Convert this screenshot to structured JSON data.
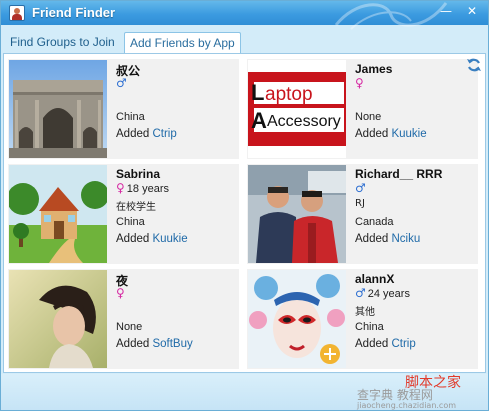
{
  "window": {
    "title": "Friend Finder",
    "minimize_glyph": "—",
    "close_glyph": "✕"
  },
  "tabs": [
    {
      "label": "Find Groups to Join",
      "selected": false
    },
    {
      "label": "Add Friends by App",
      "selected": true
    }
  ],
  "accent_color": "#3c9be0",
  "link_color": "#1f6aa8",
  "added_prefix": "Added",
  "toolbar": {
    "refresh_icon": "refresh-icon"
  },
  "friends": [
    {
      "name": "叔公",
      "gender_symbol": "♂",
      "gender": "male",
      "age": "",
      "note": "",
      "location": "China",
      "app": "Ctrip",
      "photo": "arch-photo"
    },
    {
      "name": "James",
      "gender_symbol": "♀",
      "gender": "female",
      "age": "",
      "note": "",
      "location": "None",
      "app": "Kuukie",
      "photo": "laptop-accessory-logo",
      "photo_text_1": "aptop",
      "photo_text_2": "Accessory"
    },
    {
      "name": "Sabrina",
      "gender_symbol": "♀",
      "gender": "female",
      "age": "18 years",
      "note": "在校学生",
      "location": "China",
      "app": "Kuukie",
      "photo": "cartoon-house-illustration"
    },
    {
      "name": "Richard__ RRR",
      "gender_symbol": "♂",
      "gender": "male",
      "age": "",
      "note": "RJ",
      "location": "Canada",
      "app": "Nciku",
      "photo": "two-men-photo"
    },
    {
      "name": "夜",
      "gender_symbol": "♀",
      "gender": "female",
      "age": "",
      "note": "",
      "location": "None",
      "app": "SoftBuy",
      "photo": "portrait-photo"
    },
    {
      "name": "alannX",
      "gender_symbol": "♂",
      "gender": "male",
      "age": "24 years",
      "note": "其他",
      "location": "China",
      "app": "Ctrip",
      "photo": "opera-mask-illustration"
    }
  ],
  "watermark": {
    "chinese": "脚本之家",
    "site": "查字典 教程网",
    "url": "jiaocheng.chazidian.com"
  }
}
